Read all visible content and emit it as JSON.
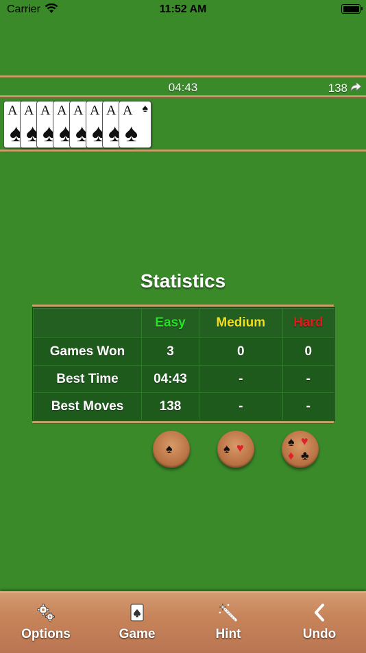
{
  "status_bar": {
    "carrier": "Carrier",
    "time": "11:52 AM"
  },
  "info": {
    "timer": "04:43",
    "moves": "138"
  },
  "foundation": {
    "cards": [
      {
        "rank": "A",
        "suit": "♠"
      },
      {
        "rank": "A",
        "suit": "♠"
      },
      {
        "rank": "A",
        "suit": "♠"
      },
      {
        "rank": "A",
        "suit": "♠"
      },
      {
        "rank": "A",
        "suit": "♠"
      },
      {
        "rank": "A",
        "suit": "♠"
      },
      {
        "rank": "A",
        "suit": "♠"
      },
      {
        "rank": "A",
        "suit": "♠"
      }
    ]
  },
  "statistics": {
    "title": "Statistics",
    "columns": [
      "Easy",
      "Medium",
      "Hard"
    ],
    "rows": [
      {
        "label": "Games Won",
        "values": [
          "3",
          "0",
          "0"
        ]
      },
      {
        "label": "Best Time",
        "values": [
          "04:43",
          "-",
          "-"
        ]
      },
      {
        "label": "Best Moves",
        "values": [
          "138",
          "-",
          "-"
        ]
      }
    ],
    "colors": {
      "easy": "#28e028",
      "medium": "#f0e020",
      "hard": "#e01a1a"
    }
  },
  "difficulty_buttons": [
    {
      "name": "one-suit",
      "suits": [
        "♠"
      ]
    },
    {
      "name": "two-suits",
      "suits": [
        "♠",
        "♥"
      ]
    },
    {
      "name": "four-suits",
      "suits": [
        "♠",
        "♥",
        "♦",
        "♣"
      ]
    }
  ],
  "toolbar": {
    "options_label": "Options",
    "game_label": "Game",
    "hint_label": "Hint",
    "undo_label": "Undo"
  }
}
